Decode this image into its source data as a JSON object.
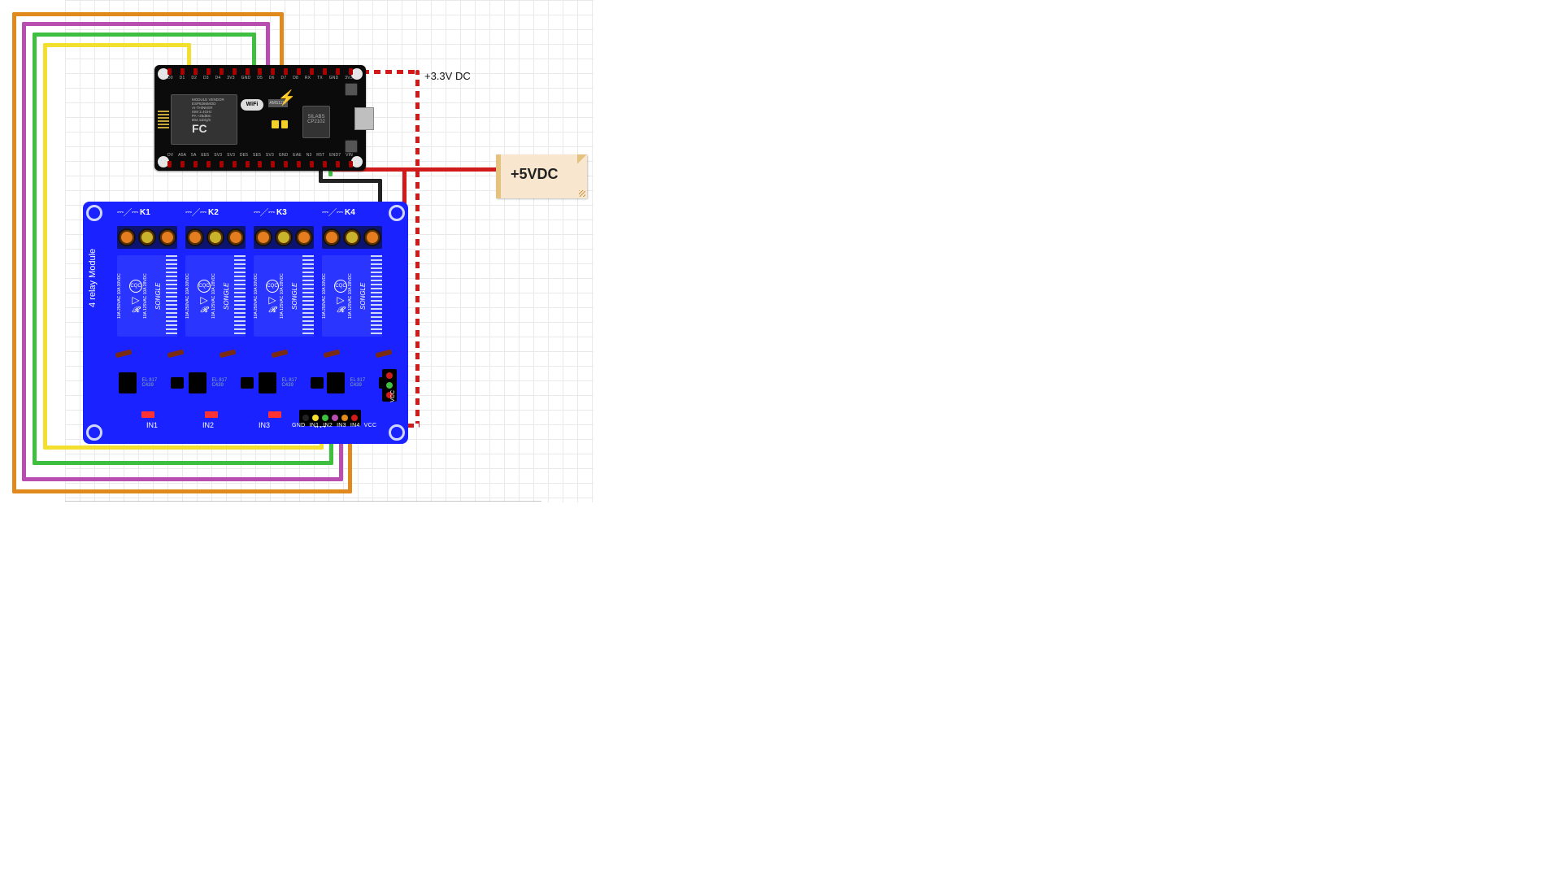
{
  "annotations": {
    "v33": "+3.3V DC",
    "v5": "+5VDC"
  },
  "mcu": {
    "top_pins": [
      "D0",
      "D1",
      "D2",
      "D3",
      "D4",
      "3V3",
      "GND",
      "D5",
      "D6",
      "D7",
      "D8",
      "RX",
      "TX",
      "GND",
      "3V3"
    ],
    "bot_pins": [
      "DV",
      "A5A",
      "5A",
      "EE5",
      "SV3",
      "SV3",
      "DE5",
      "SE5",
      "SV3",
      "GND",
      "EAE",
      "N3",
      "R5T",
      "END7",
      "VIN"
    ],
    "vendor": "MODULE\nVENDOR",
    "chip_model": "ESP8266MOD",
    "chip_brand": "AI-THINKER",
    "ism": "ISM 2.4GHz",
    "pa": "PA +25dBm",
    "wifi_std": "802.11b/g/n",
    "wifi_badge": "WiFi",
    "fcc": "FC",
    "ams": "AMS1117",
    "usb_serial": "SILABS\nCP2102"
  },
  "relay": {
    "title": "4 relay Module",
    "k_labels": [
      "K1",
      "K2",
      "K3",
      "K4"
    ],
    "ratings": [
      "10A 250VAC",
      "10A 125VAC",
      "10A 30VDC",
      "10A 28VDC"
    ],
    "brand": "SONGLE",
    "cqc": "CQC",
    "ul": "𝓡",
    "in_labels": [
      "IN1",
      "IN2",
      "IN3",
      "IN4"
    ],
    "header_labels": [
      "GND",
      "IN1",
      "IN2",
      "IN3",
      "IN4",
      "VCC"
    ],
    "vcc_side": "VCC",
    "opto": "EL\n817\nC439"
  },
  "wires": {
    "colors": {
      "orange": "#e08a1e",
      "purple": "#b84fb0",
      "yellow": "#f3df2e",
      "green": "#3fbf3f",
      "red": "#d11a1a",
      "black": "#222222",
      "red_striped": "repeating-linear-gradient(90deg,#d11a1a 0 8px,#ffffff 8px 14px)",
      "red_striped_v": "repeating-linear-gradient(0deg,#d11a1a 0 8px,#ffffff 8px 14px)"
    }
  }
}
